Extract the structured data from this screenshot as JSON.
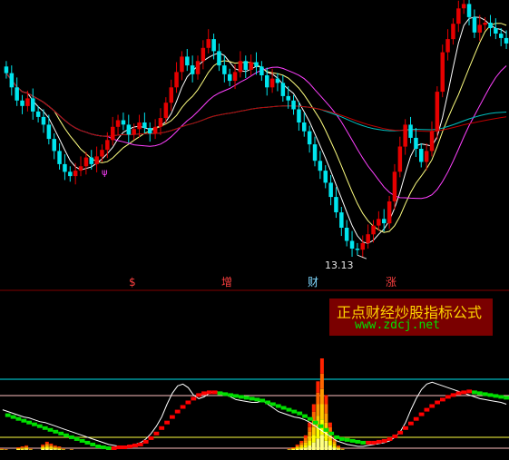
{
  "colors": {
    "up": "#e60000",
    "down": "#00e5ee",
    "flat": "#ffff00",
    "ma5": "#ffffff",
    "ma10": "#ffff80",
    "ma20": "#ff40ff",
    "ma60": "#00c0c0",
    "ma120": "#c00000",
    "osc_white": "#ffffff",
    "osc_red": "#ff0000",
    "osc_green": "#00e000",
    "ref_cyan": "#00e5ee",
    "ref_pink": "#ffc0c0",
    "ref_yellow": "#ffff40"
  },
  "chart_data": [
    {
      "type": "candlestick",
      "annotations": {
        "low_price_label": "13.13",
        "marker_left": "ψ"
      },
      "signal_labels": [
        "$",
        "增",
        "财",
        "涨"
      ],
      "closes": [
        29.5,
        28.2,
        27.0,
        26.5,
        27.2,
        26.0,
        25.5,
        24.8,
        23.5,
        22.4,
        21.2,
        20.5,
        20.1,
        20.6,
        21.0,
        21.8,
        21.2,
        21.9,
        22.5,
        23.4,
        24.6,
        25.2,
        24.8,
        23.9,
        24.4,
        25.0,
        24.5,
        24.0,
        24.6,
        25.4,
        26.8,
        28.2,
        29.6,
        31.0,
        30.2,
        29.4,
        30.6,
        31.8,
        32.6,
        31.5,
        30.2,
        29.4,
        28.8,
        29.6,
        30.6,
        29.8,
        30.5,
        30.1,
        29.3,
        28.2,
        29.0,
        28.6,
        27.4,
        27.0,
        26.2,
        25.0,
        24.2,
        23.0,
        21.5,
        20.6,
        19.5,
        18.2,
        16.8,
        15.4,
        14.2,
        13.5,
        13.4,
        14.0,
        14.8,
        15.6,
        16.2,
        15.8,
        17.8,
        20.5,
        22.8,
        24.8,
        23.6,
        22.6,
        21.4,
        22.4,
        24.2,
        27.8,
        31.4,
        32.6,
        34.0,
        35.4,
        35.8,
        34.6,
        33.2,
        33.9,
        34.1,
        33.6,
        33.1,
        32.7,
        32.2
      ]
    },
    {
      "type": "bar",
      "indicator": "stacked_heat_histogram",
      "values": [
        2,
        1,
        0,
        0,
        3,
        4,
        5,
        2,
        0,
        0,
        6,
        9,
        7,
        5,
        4,
        2,
        0,
        1,
        0,
        0,
        0,
        0,
        0,
        0,
        0,
        0,
        0,
        0,
        0,
        0,
        0,
        0,
        0,
        0,
        0,
        0,
        0,
        0,
        0,
        0,
        0,
        0,
        0,
        0,
        0,
        0,
        0,
        0,
        0,
        0,
        0,
        0,
        0,
        0,
        0,
        0,
        0,
        0,
        0,
        0,
        0,
        0,
        0,
        0,
        0,
        0,
        0,
        0,
        0,
        0,
        2,
        3,
        6,
        10,
        16,
        30,
        50,
        75,
        100,
        60,
        30,
        14,
        5,
        2,
        0,
        0,
        0,
        0,
        0,
        0,
        0,
        0,
        0,
        0,
        0,
        0,
        0,
        0,
        0,
        0,
        0,
        0,
        0,
        0,
        0,
        0,
        0,
        0,
        0,
        0,
        0,
        0,
        0,
        0,
        0,
        0,
        0,
        0,
        0,
        0,
        0,
        0,
        0,
        0
      ],
      "trend_values": [
        40,
        38,
        36,
        34,
        32,
        30,
        28,
        26,
        24,
        22,
        20,
        18,
        16,
        14,
        12,
        10,
        8,
        6,
        4,
        3,
        2,
        2,
        3,
        3,
        4,
        5,
        6,
        9,
        13,
        18,
        24,
        30,
        36,
        42,
        47,
        52,
        56,
        60,
        62,
        63,
        63,
        62,
        61,
        60,
        59,
        58,
        57,
        56,
        55,
        54,
        52,
        50,
        48,
        46,
        44,
        42,
        40,
        37,
        34,
        30,
        26,
        22,
        18,
        14,
        12,
        11,
        10,
        9,
        8,
        8,
        8,
        9,
        10,
        12,
        15,
        19,
        24,
        29,
        34,
        39,
        44,
        48,
        52,
        55,
        58,
        60,
        62,
        63,
        64,
        63,
        62,
        61,
        60,
        59,
        58,
        57
      ],
      "line_values": [
        44,
        42,
        40,
        38,
        36,
        35,
        33,
        31,
        30,
        28,
        26,
        24,
        22,
        20,
        18,
        16,
        14,
        12,
        10,
        8,
        6,
        5,
        4,
        4,
        5,
        6,
        8,
        12,
        18,
        26,
        36,
        50,
        62,
        70,
        72,
        68,
        60,
        56,
        58,
        62,
        64,
        63,
        61,
        58,
        55,
        54,
        53,
        52,
        52,
        54,
        50,
        46,
        42,
        40,
        38,
        36,
        35,
        33,
        30,
        26,
        22,
        18,
        14,
        10,
        8,
        6,
        5,
        4,
        4,
        5,
        6,
        7,
        8,
        10,
        14,
        20,
        30,
        44,
        56,
        66,
        72,
        74,
        72,
        70,
        68,
        66,
        64,
        62,
        60,
        58,
        56,
        55,
        54,
        53,
        52,
        50
      ]
    }
  ],
  "brand": {
    "title": "正点财经炒股指标公式",
    "url": "www.zdcj.net"
  }
}
